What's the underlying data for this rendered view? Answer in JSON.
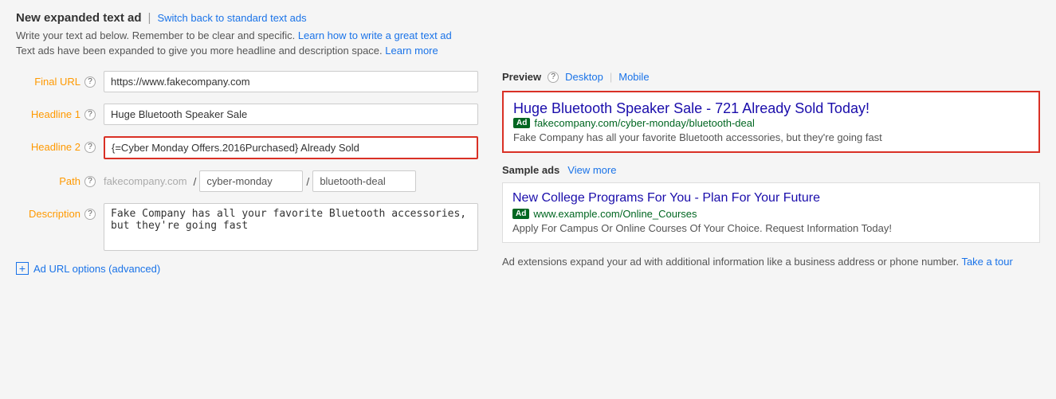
{
  "header": {
    "title": "New expanded text ad",
    "separator": "|",
    "switch_link": "Switch back to standard text ads"
  },
  "info_lines": {
    "line1_prefix": "Write your text ad below. Remember to be clear and specific. ",
    "line1_link": "Learn how to write a great text ad",
    "line2_prefix": "Text ads have been expanded to give you more headline and description space. ",
    "line2_link": "Learn more"
  },
  "form": {
    "final_url_label": "Final URL",
    "final_url_value": "https://www.fakecompany.com",
    "headline1_label": "Headline 1",
    "headline1_value": "Huge Bluetooth Speaker Sale",
    "headline2_label": "Headline 2",
    "headline2_value": "{=Cyber Monday Offers.2016Purchased} Already Sold",
    "path_label": "Path",
    "path_base": "fakecompany.com",
    "path1_value": "cyber-monday",
    "path2_value": "bluetooth-deal",
    "description_label": "Description",
    "description_value": "Fake Company has all your favorite Bluetooth accessories, but they're going fast",
    "ad_url_options_label": "Ad URL options (advanced)"
  },
  "preview": {
    "title": "Preview",
    "tab_desktop": "Desktop",
    "tab_mobile": "Mobile",
    "ad_headline": "Huge Bluetooth Speaker Sale - 721 Already Sold Today!",
    "ad_badge": "Ad",
    "ad_url": "fakecompany.com/cyber-monday/bluetooth-deal",
    "ad_description": "Fake Company has all your favorite Bluetooth accessories, but they're going fast"
  },
  "sample_ads": {
    "title": "Sample ads",
    "view_more": "View more",
    "ad1_headline": "New College Programs For You - Plan For Your Future",
    "ad1_badge": "Ad",
    "ad1_url": "www.example.com/Online_Courses",
    "ad1_description": "Apply For Campus Or Online Courses Of Your Choice. Request Information Today!"
  },
  "ad_extensions": {
    "text": "Ad extensions expand your ad with additional information like a business address or phone number. ",
    "take_tour": "Take a tour"
  },
  "help_icon_label": "?"
}
